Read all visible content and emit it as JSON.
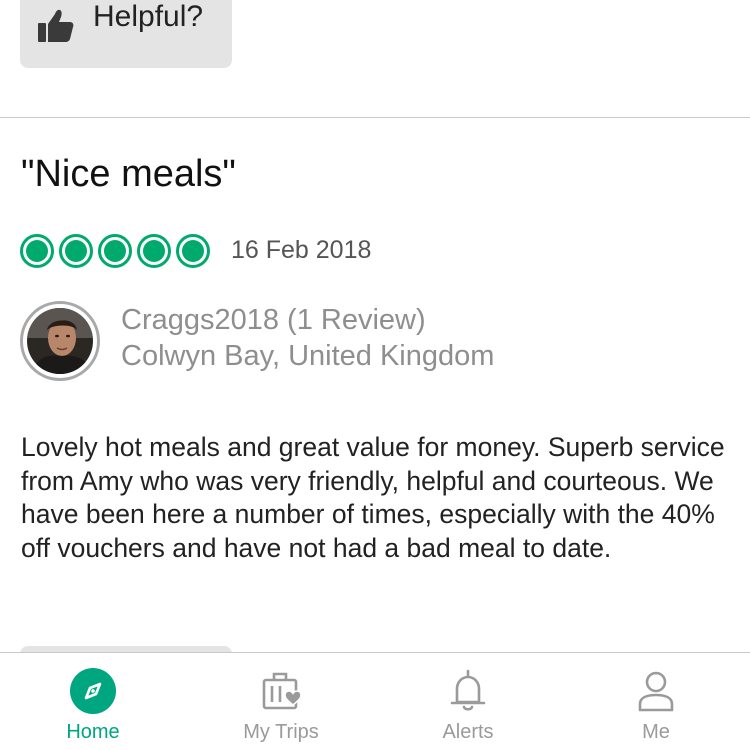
{
  "previous_review": {
    "helpful_label": "Helpful?",
    "icon": "thumbs-up-icon"
  },
  "review": {
    "title": "\"Nice meals\"",
    "rating": 5,
    "rating_max": 5,
    "date": "16 Feb 2018",
    "reviewer": {
      "name": "Craggs2018 (1 Review)",
      "location": "Colwyn Bay, United Kingdom"
    },
    "body": "Lovely hot meals and great value for money. Superb service from Amy who was very friendly, helpful and courteous. We have been here a number of times, especially with the 40% off vouchers and have not had a bad meal to date."
  },
  "tabbar": {
    "tabs": [
      {
        "label": "Home",
        "icon": "compass-icon",
        "active": true
      },
      {
        "label": "My Trips",
        "icon": "suitcase-heart-icon",
        "active": false
      },
      {
        "label": "Alerts",
        "icon": "bell-icon",
        "active": false
      },
      {
        "label": "Me",
        "icon": "person-icon",
        "active": false
      }
    ]
  },
  "colors": {
    "accent": "#00aa6c",
    "active_tab": "#00a680",
    "inactive_tab": "#9a9a9a",
    "button_bg": "#e4e4e4"
  }
}
